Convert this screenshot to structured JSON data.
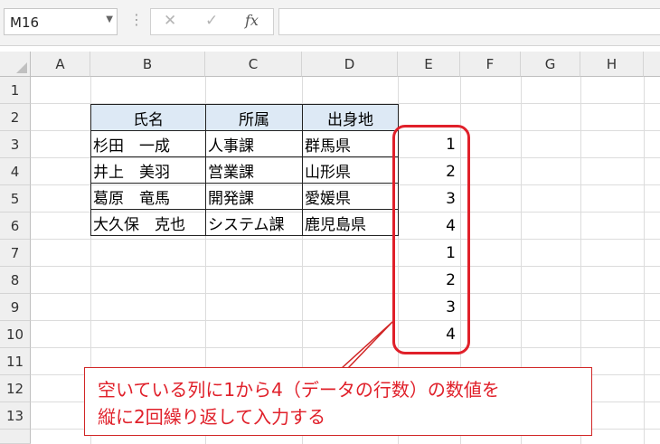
{
  "formula_bar": {
    "name_box": "M16",
    "cancel_icon": "✕",
    "enter_icon": "✓",
    "function_label": "fx"
  },
  "columns": [
    "A",
    "B",
    "C",
    "D",
    "E",
    "F",
    "G",
    "H"
  ],
  "rows": [
    "1",
    "2",
    "3",
    "4",
    "5",
    "6",
    "7",
    "8",
    "9",
    "10",
    "11",
    "12",
    "13"
  ],
  "table": {
    "headers": [
      "氏名",
      "所属",
      "出身地"
    ],
    "rows": [
      [
        "杉田　一成",
        "人事課",
        "群馬県"
      ],
      [
        "井上　美羽",
        "営業課",
        "山形県"
      ],
      [
        "葛原　竜馬",
        "開発課",
        "愛媛県"
      ],
      [
        "大久保　克也",
        "システム課",
        "鹿児島県"
      ]
    ]
  },
  "column_e_values": [
    "1",
    "2",
    "3",
    "4",
    "1",
    "2",
    "3",
    "4"
  ],
  "annotation": {
    "line1": "空いている列に1から4（データの行数）の数値を",
    "line2": "縦に2回繰り返して入力する",
    "color": "#e0202a"
  }
}
